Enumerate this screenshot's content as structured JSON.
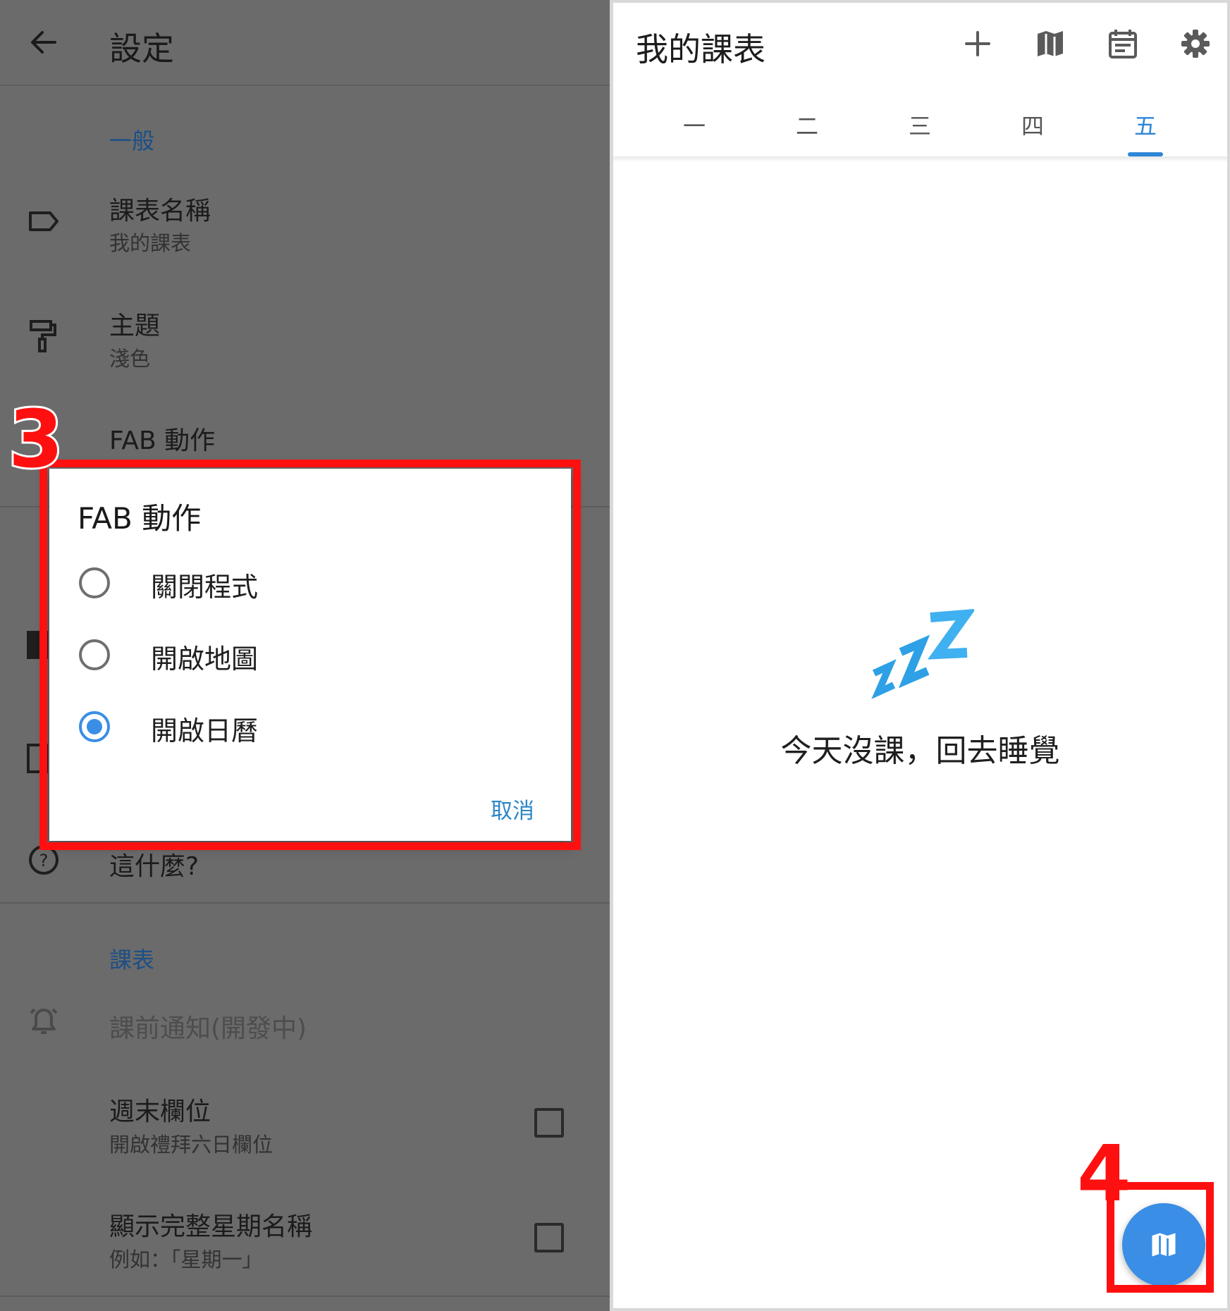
{
  "settings": {
    "title": "設定",
    "general_header": "一般",
    "items": [
      {
        "title": "課表名稱",
        "subtitle": "我的課表"
      },
      {
        "title": "主題",
        "subtitle": "淺色"
      },
      {
        "title": "FAB 動作"
      },
      {
        "title": "這什麼?"
      }
    ],
    "schedule_header": "課表",
    "notify_label": "課前通知(開發中)",
    "weekend": {
      "title": "週末欄位",
      "subtitle": "開啟禮拜六日欄位"
    },
    "full_weekday": {
      "title": "顯示完整星期名稱",
      "subtitle": "例如：「星期一」"
    }
  },
  "dialog": {
    "title": "FAB 動作",
    "options": [
      "關閉程式",
      "開啟地圖",
      "開啟日曆"
    ],
    "selected_index": 2,
    "cancel_label": "取消"
  },
  "schedule": {
    "title": "我的課表",
    "tabs": [
      "一",
      "二",
      "三",
      "四",
      "五"
    ],
    "active_tab_index": 4,
    "empty_message": "今天沒課，回去睡覺",
    "accent_color": "#2f86d8"
  },
  "annotations": {
    "step3": "3",
    "step4": "4",
    "color": "#ff1010"
  }
}
